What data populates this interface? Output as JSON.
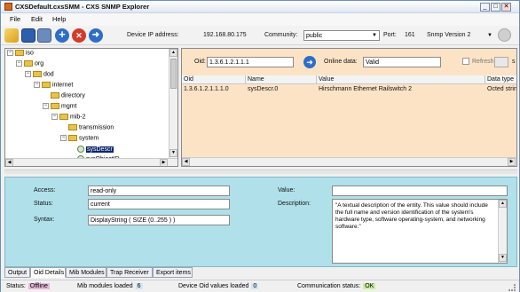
{
  "window": {
    "title": "CXSDefault.cxsSMM - CXS SNMP Explorer",
    "min": "_",
    "max": "□",
    "close": "✕"
  },
  "menu": {
    "file": "File",
    "edit": "Edit",
    "help": "Help"
  },
  "toolbar": {
    "device_ip_label": "Device IP address:",
    "device_ip_value": "192.168.80.175",
    "community_label": "Community:",
    "community_value": "public",
    "port_label": "Port:",
    "port_value": "161",
    "snmp_version": "Snmp Version 2"
  },
  "tree": {
    "nodes": [
      {
        "label": "iso",
        "expander": "−",
        "kind": "folder"
      },
      {
        "label": "org",
        "expander": "−",
        "kind": "folder"
      },
      {
        "label": "dod",
        "expander": "−",
        "kind": "folder"
      },
      {
        "label": "internet",
        "expander": "−",
        "kind": "folder"
      },
      {
        "label": "directory",
        "expander": "",
        "kind": "folder"
      },
      {
        "label": "mgmt",
        "expander": "−",
        "kind": "folder"
      },
      {
        "label": "mib-2",
        "expander": "−",
        "kind": "folder"
      },
      {
        "label": "transmission",
        "expander": "",
        "kind": "folder"
      },
      {
        "label": "system",
        "expander": "−",
        "kind": "folder"
      },
      {
        "label": "sysDescr",
        "expander": "",
        "kind": "leaf"
      },
      {
        "label": "sysObjectID",
        "expander": "",
        "kind": "leaf"
      }
    ]
  },
  "oid_bar": {
    "oid_label": "Oid:",
    "oid_value": "1.3.6.1.2.1.1.1",
    "online_label": "Online data:",
    "online_value": "Valid",
    "refresh_label": "Refresh:",
    "refresh_unit": "s"
  },
  "table": {
    "headers": [
      "Oid",
      "Name",
      "Value",
      "Data type"
    ],
    "rows": [
      [
        "1.3.6.1.2.1.1.1.0",
        "sysDescr.0",
        "Hirschmann Ethernet Railswitch 2",
        "Octed string"
      ]
    ]
  },
  "details": {
    "access_label": "Access:",
    "access_value": "read-only",
    "status_label": "Status:",
    "status_value": "current",
    "syntax_label": "Syntax:",
    "syntax_value": "DisplayString ( SIZE (0..255 ) )",
    "value_label": "Value:",
    "value_value": "",
    "description_label": "Description:",
    "description_value": "\"A textual description of the entity.  This value should include the full name and version identification of the system's hardware type, software operating-system, and networking software.\""
  },
  "tabs": [
    "Output",
    "Oid Details",
    "Mib Modules",
    "Trap Receiver",
    "Export items"
  ],
  "status": {
    "status_label": "Status:",
    "status_value": "Offline",
    "mib_label": "Mib modules loaded",
    "mib_value": "6",
    "device_label": "Device Oid values loaded",
    "device_value": "0",
    "comm_label": "Communication status:",
    "comm_value": "OK"
  },
  "colors": {
    "offline_bg": "#e6b8d8",
    "count_bg": "#cfe6f5",
    "ok_bg": "#c8f0a0",
    "details_bg": "#b0e0ea",
    "table_row_bg": "#fde3c6"
  }
}
